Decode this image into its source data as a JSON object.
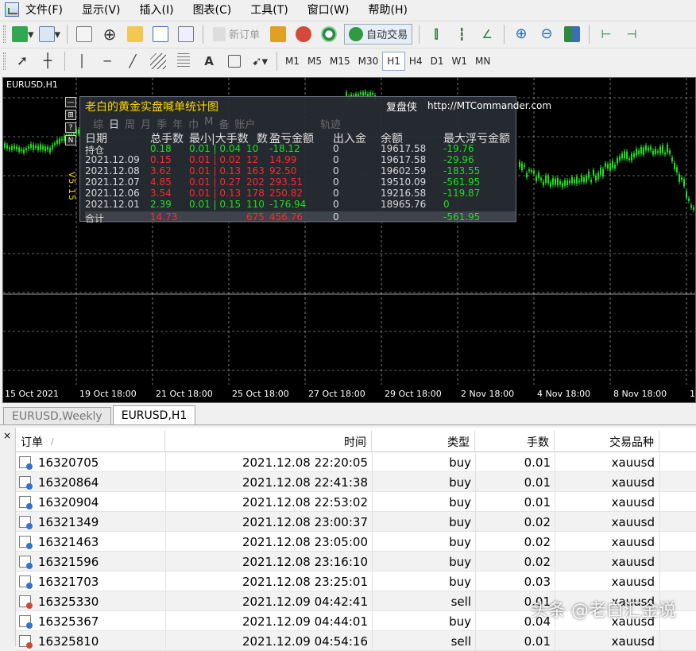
{
  "menu": [
    "文件(F)",
    "显示(V)",
    "插入(I)",
    "图表(C)",
    "工具(T)",
    "窗口(W)",
    "帮助(H)"
  ],
  "toolbar1": {
    "new_order": "新订单",
    "autotrade": "自动交易"
  },
  "toolbar2": {
    "text_tool": "A",
    "timeframes": [
      "M1",
      "M5",
      "M15",
      "M30",
      "H1",
      "H4",
      "D1",
      "W1",
      "MN"
    ],
    "active_timeframe": "H1"
  },
  "chart": {
    "title": "EURUSD,H1",
    "time_labels": [
      "15 Oct 2021",
      "19 Oct 18:00",
      "21 Oct 18:00",
      "25 Oct 18:00",
      "27 Oct 18:00",
      "29 Oct 18:00",
      "2 Nov 18:00",
      "4 Nov 18:00",
      "8 Nov 18:00",
      "1"
    ],
    "candle_color": "#19e319",
    "grid_color": "#c8c8c8"
  },
  "panel": {
    "title": "老白的黄金实盘喊单统计图",
    "brand": "复盘侠",
    "url": "http://MTCommander.com",
    "version": "V5.15",
    "side_buttons": [
      "—",
      "⊞",
      "?",
      "N"
    ],
    "tabs": [
      "综",
      "日",
      "周",
      "月",
      "季",
      "年",
      "巾",
      "M",
      "备",
      "账户"
    ],
    "active_tab": "日",
    "track_tab": "轨迹",
    "headers": [
      "日期",
      "总手数",
      "最小|大手数",
      "数",
      "盈亏金额",
      "出入金",
      "余额",
      "最大浮亏金额"
    ],
    "rows": [
      {
        "date": "持仓",
        "lots": "0.18",
        "minmax": "0.01 | 0.04",
        "count": "10",
        "pl": "-18.12",
        "io": "0",
        "balance": "19617.58",
        "dd": "-19.76",
        "tone": "green"
      },
      {
        "date": "2021.12.09",
        "lots": "0.15",
        "minmax": "0.01 | 0.02",
        "count": "12",
        "pl": "14.99",
        "io": "0",
        "balance": "19617.58",
        "dd": "-29.96",
        "tone": "red"
      },
      {
        "date": "2021.12.08",
        "lots": "3.62",
        "minmax": "0.01 | 0.13",
        "count": "163",
        "pl": "92.50",
        "io": "0",
        "balance": "19602.59",
        "dd": "-183.55",
        "tone": "red"
      },
      {
        "date": "2021.12.07",
        "lots": "4.85",
        "minmax": "0.01 | 0.27",
        "count": "202",
        "pl": "293.51",
        "io": "0",
        "balance": "19510.09",
        "dd": "-561.95",
        "tone": "red"
      },
      {
        "date": "2021.12.06",
        "lots": "3.54",
        "minmax": "0.01 | 0.13",
        "count": "178",
        "pl": "250.82",
        "io": "0",
        "balance": "19216.58",
        "dd": "-119.87",
        "tone": "red"
      },
      {
        "date": "2021.12.01",
        "lots": "2.39",
        "minmax": "0.01 | 0.15",
        "count": "110",
        "pl": "-176.94",
        "io": "0",
        "balance": "18965.76",
        "dd": "0",
        "tone": "green"
      }
    ],
    "total": {
      "date": "合计",
      "lots": "14.73",
      "count": "675",
      "pl": "456.76",
      "io": "0",
      "dd": "-561.95"
    }
  },
  "chart_tabs": [
    "EURUSD,Weekly",
    "EURUSD,H1"
  ],
  "active_chart_tab": "EURUSD,H1",
  "terminal": {
    "close": "×",
    "columns": [
      "订单",
      "时间",
      "类型",
      "手数",
      "交易品种"
    ],
    "sort_arrow": "/",
    "rows": [
      {
        "order": "16320705",
        "time": "2021.12.08 22:20:05",
        "type": "buy",
        "lots": "0.01",
        "symbol": "xauusd"
      },
      {
        "order": "16320864",
        "time": "2021.12.08 22:41:38",
        "type": "buy",
        "lots": "0.01",
        "symbol": "xauusd"
      },
      {
        "order": "16320904",
        "time": "2021.12.08 22:53:02",
        "type": "buy",
        "lots": "0.01",
        "symbol": "xauusd"
      },
      {
        "order": "16321349",
        "time": "2021.12.08 23:00:37",
        "type": "buy",
        "lots": "0.02",
        "symbol": "xauusd"
      },
      {
        "order": "16321463",
        "time": "2021.12.08 23:05:00",
        "type": "buy",
        "lots": "0.02",
        "symbol": "xauusd"
      },
      {
        "order": "16321596",
        "time": "2021.12.08 23:16:10",
        "type": "buy",
        "lots": "0.02",
        "symbol": "xauusd"
      },
      {
        "order": "16321703",
        "time": "2021.12.08 23:25:01",
        "type": "buy",
        "lots": "0.03",
        "symbol": "xauusd"
      },
      {
        "order": "16325330",
        "time": "2021.12.09 04:42:41",
        "type": "sell",
        "lots": "0.01",
        "symbol": "xauusd"
      },
      {
        "order": "16325367",
        "time": "2021.12.09 04:44:01",
        "type": "buy",
        "lots": "0.04",
        "symbol": "xauusd"
      },
      {
        "order": "16325810",
        "time": "2021.12.09 04:54:16",
        "type": "sell",
        "lots": "0.01",
        "symbol": "xauusd"
      }
    ]
  },
  "watermark": "头条 @老白汇金说"
}
